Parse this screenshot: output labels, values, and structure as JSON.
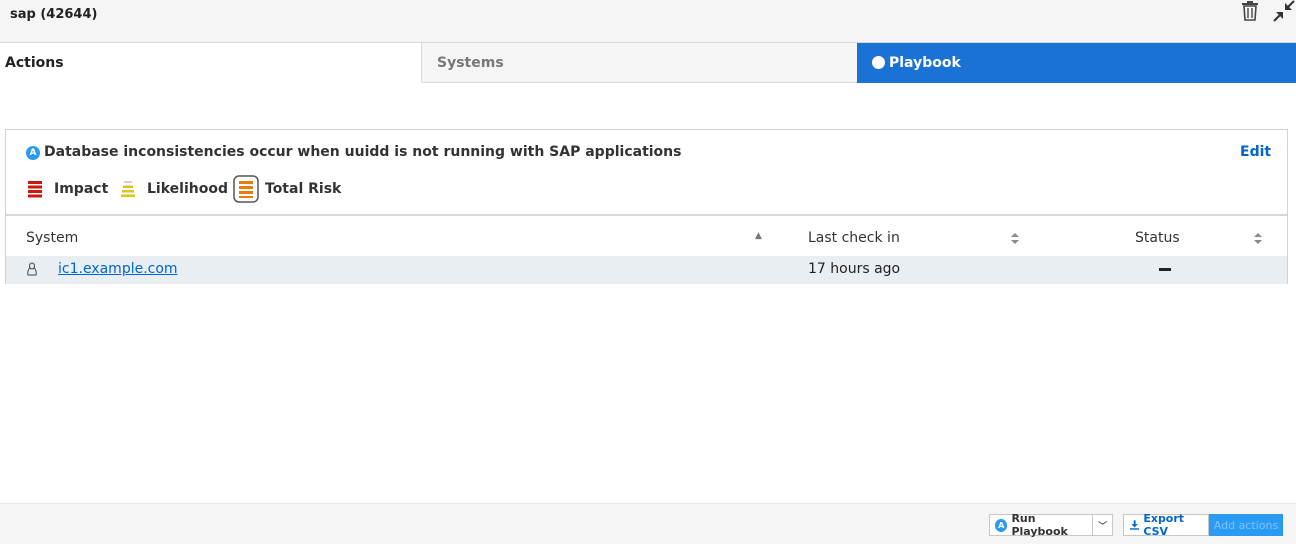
{
  "header": {
    "title": "sap (42644)",
    "icons": [
      "trash-icon",
      "collapse-icon"
    ]
  },
  "tabs": [
    {
      "label": "Actions",
      "state": "active"
    },
    {
      "label": "Systems",
      "state": "inactive"
    },
    {
      "label": "Playbook",
      "state": "highlighted"
    }
  ],
  "rule": {
    "badge": "A",
    "title": "Database inconsistencies occur when uuidd is not running with SAP applications",
    "edit_label": "Edit",
    "risk": {
      "impact_label": "Impact",
      "likelihood_label": "Likelihood",
      "total_label": "Total Risk"
    }
  },
  "table": {
    "columns": [
      "System",
      "Last check in",
      "Status"
    ],
    "sort": {
      "System": "ascending",
      "Last check in": "unsorted",
      "Status": "unsorted"
    },
    "rows": [
      {
        "system": "ic1.example.com",
        "os_icon": "linux-penguin-icon",
        "last_check_in": "17 hours ago",
        "status": "—"
      }
    ]
  },
  "footer": {
    "run_badge": "A",
    "run_label": "Run Playbook",
    "export_label": "Export CSV",
    "add_label": "Add actions"
  },
  "colors": {
    "accent": "#1a73d4",
    "link": "#0066cc",
    "impact": "#c9190b",
    "likelihood": "#e0c21a",
    "total_risk": "#ec7a08"
  }
}
